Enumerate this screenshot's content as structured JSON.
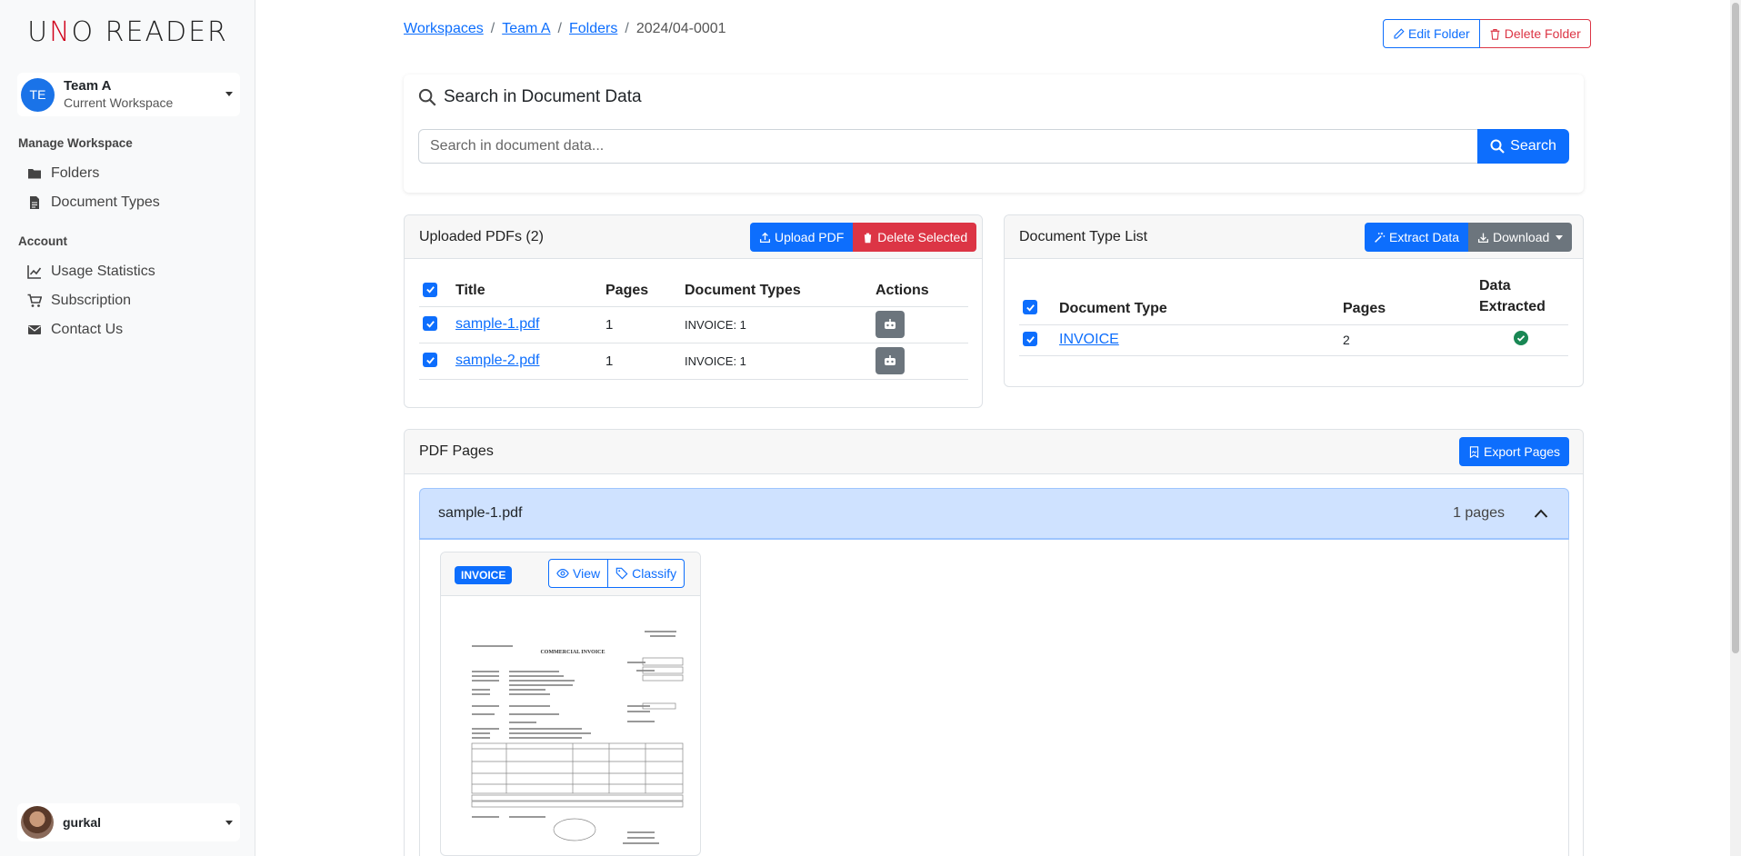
{
  "sidebar": {
    "logo_pre": "U",
    "logo_n": "N",
    "logo_post": "O READER",
    "workspace": {
      "initials": "TE",
      "name": "Team A",
      "subtitle": "Current Workspace"
    },
    "manage_heading": "Manage Workspace",
    "manage_items": [
      {
        "label": "Folders",
        "icon": "folder-icon"
      },
      {
        "label": "Document Types",
        "icon": "file-icon"
      }
    ],
    "account_heading": "Account",
    "account_items": [
      {
        "label": "Usage Statistics",
        "icon": "chart-line-icon"
      },
      {
        "label": "Subscription",
        "icon": "cart-icon"
      },
      {
        "label": "Contact Us",
        "icon": "envelope-icon"
      }
    ],
    "user": {
      "name": "gurkal"
    }
  },
  "breadcrumb": {
    "items": [
      "Workspaces",
      "Team A",
      "Folders"
    ],
    "current": "2024/04-0001",
    "separator": "/"
  },
  "header_actions": {
    "edit": "Edit Folder",
    "delete": "Delete Folder"
  },
  "search": {
    "title": "Search in Document Data",
    "placeholder": "Search in document data...",
    "button": "Search"
  },
  "uploaded": {
    "title": "Uploaded PDFs (2)",
    "upload_button": "Upload PDF",
    "delete_button": "Delete Selected",
    "columns": [
      "Title",
      "Pages",
      "Document Types",
      "Actions"
    ],
    "rows": [
      {
        "title": "sample-1.pdf",
        "pages": "1",
        "types": "INVOICE: 1"
      },
      {
        "title": "sample-2.pdf",
        "pages": "1",
        "types": "INVOICE: 1"
      }
    ]
  },
  "doctypes": {
    "title": "Document Type List",
    "extract_button": "Extract Data",
    "download_button": "Download",
    "columns": [
      "Document Type",
      "Pages",
      "Data",
      "Extracted"
    ],
    "rows": [
      {
        "type": "INVOICE",
        "pages": "2",
        "extracted": true
      }
    ]
  },
  "pdf_pages": {
    "title": "PDF Pages",
    "export_button": "Export Pages",
    "file": {
      "name": "sample-1.pdf",
      "count": "1 pages"
    },
    "thumb": {
      "badge": "INVOICE",
      "view": "View",
      "classify": "Classify",
      "doc_heading": "COMMERCIAL INVOICE"
    }
  },
  "colors": {
    "primary": "#0d6efd",
    "danger": "#dc3545",
    "secondary": "#6c757d",
    "success": "#198754",
    "accent_logo": "#d0021b"
  }
}
